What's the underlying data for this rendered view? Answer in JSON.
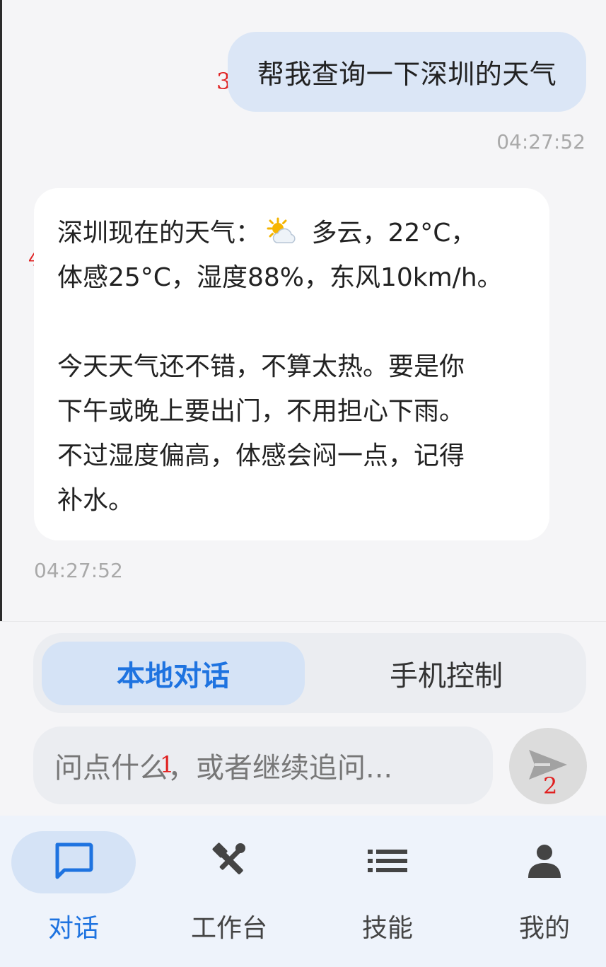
{
  "chat": {
    "user_message": "帮我查询一下深圳的天气",
    "user_time": "04:27:52",
    "bot_lines_1": [
      "深圳现在的天气：",
      " 多云，22°C，",
      "体感25°C，湿度88%，东风10km/h。"
    ],
    "bot_lines_2": [
      "今天天气还不错，不算太热。要是你",
      "下午或晚上要出门，不用担心下雨。",
      "不过湿度偏高，体感会闷一点，记得",
      "补水。"
    ],
    "bot_time": "04:27:52",
    "weather_icon": "sun-behind-cloud-icon"
  },
  "markers": {
    "m1": "1",
    "m2": "2",
    "m3": "3",
    "m4": "4"
  },
  "composer": {
    "mode_local": "本地对话",
    "mode_phone": "手机控制",
    "input_placeholder": "问点什么，或者继续追问..."
  },
  "nav": {
    "items": [
      {
        "label": "对话",
        "icon": "chat-bubble-icon",
        "active": true
      },
      {
        "label": "工作台",
        "icon": "tools-icon",
        "active": false
      },
      {
        "label": "技能",
        "icon": "list-icon",
        "active": false
      },
      {
        "label": "我的",
        "icon": "person-icon",
        "active": false
      }
    ]
  },
  "colors": {
    "accent": "#1e73e0",
    "user_bubble": "#dbe6f6",
    "marker": "#e02020"
  }
}
